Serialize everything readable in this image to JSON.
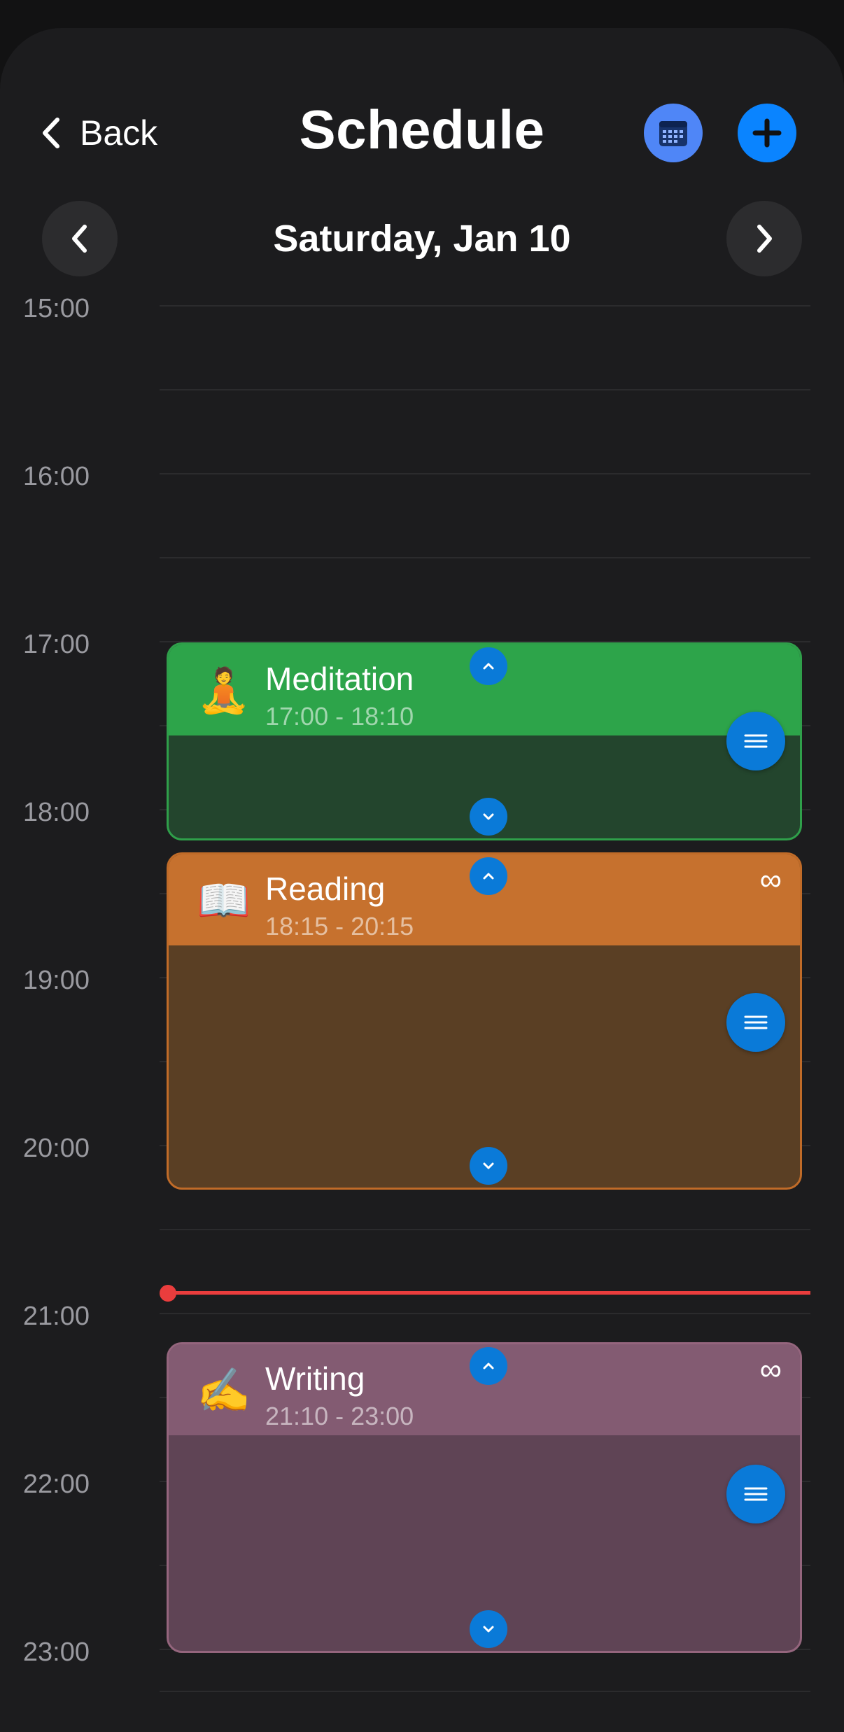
{
  "header": {
    "back_label": "Back",
    "title": "Schedule",
    "calendar_icon": "calendar-icon",
    "add_icon": "plus-icon"
  },
  "date_nav": {
    "date_label": "Saturday, Jan 10",
    "prev_icon": "chevron-left-icon",
    "next_icon": "chevron-right-icon"
  },
  "timeline": {
    "hours": [
      "15:00",
      "16:00",
      "17:00",
      "18:00",
      "19:00",
      "20:00",
      "21:00",
      "22:00",
      "23:00"
    ],
    "current_time_indicator_color": "#ea3d3d"
  },
  "events": [
    {
      "emoji": "🧘",
      "name": "Meditation",
      "time": "17:00 - 18:10",
      "recurring": false,
      "color": "#2da44a"
    },
    {
      "emoji": "📖",
      "name": "Reading",
      "time": "18:15 - 20:15",
      "recurring": true,
      "recurring_symbol": "∞",
      "color": "#c6712e"
    },
    {
      "emoji": "✍️",
      "name": "Writing",
      "time": "21:10 - 23:00",
      "recurring": true,
      "recurring_symbol": "∞",
      "color": "#835b72"
    }
  ],
  "colors": {
    "background": "#1c1c1e",
    "accent": "#0a84ff",
    "calendar_button": "#4f86f7"
  }
}
